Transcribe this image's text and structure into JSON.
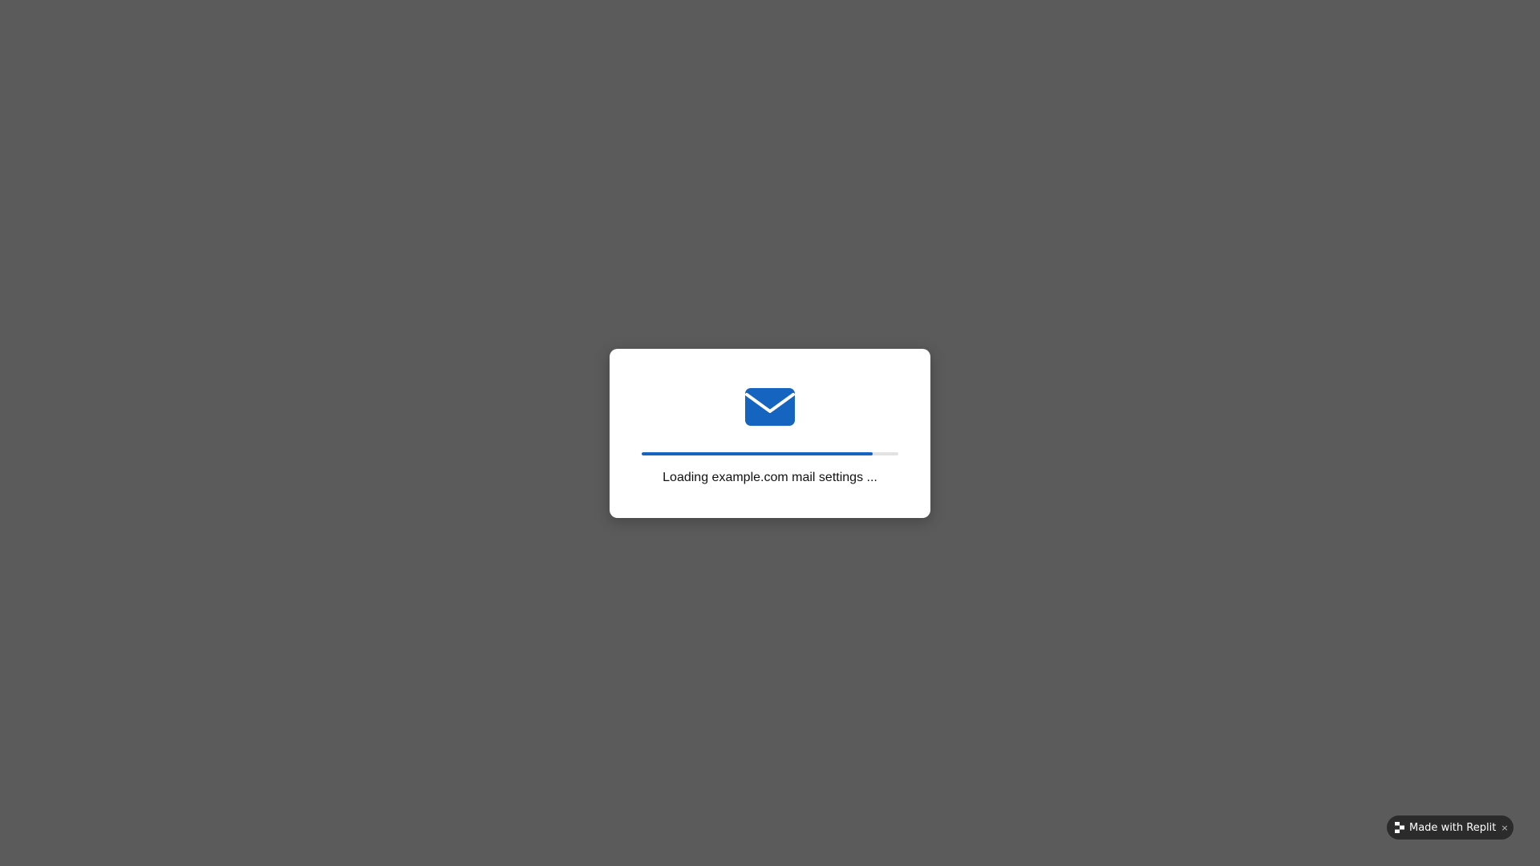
{
  "dialog": {
    "icon": "envelope-icon",
    "progress": 0.9,
    "message": "Loading example.com mail settings ..."
  },
  "badge": {
    "icon": "replit-logo-icon",
    "label": "Made with Replit",
    "close": "×"
  },
  "colors": {
    "background": "#5b5b5b",
    "accent": "#1565c0",
    "track": "#e2e2e2",
    "badge_bg": "#2b2b2b"
  }
}
